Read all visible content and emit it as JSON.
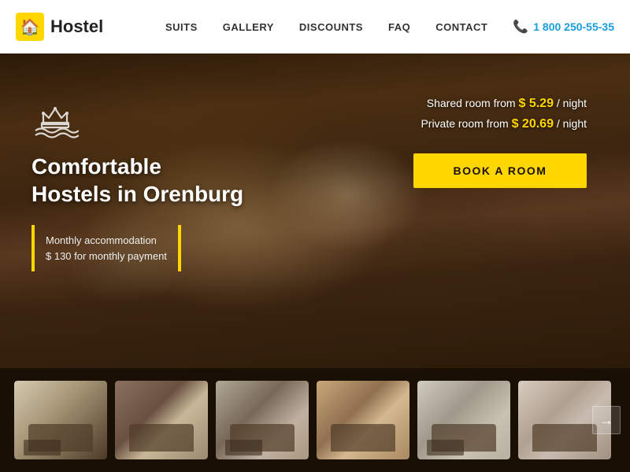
{
  "navbar": {
    "logo_icon": "🏠",
    "logo_text": "Hostel",
    "nav_items": [
      {
        "label": "SUITS",
        "id": "suits"
      },
      {
        "label": "GALLERY",
        "id": "gallery"
      },
      {
        "label": "DISCOUNTS",
        "id": "discounts"
      },
      {
        "label": "FAQ",
        "id": "faq"
      },
      {
        "label": "CONTACT",
        "id": "contact"
      }
    ],
    "phone_label": "1 800 250-55-35"
  },
  "hero": {
    "icon": "⚓",
    "title_line1": "Comfortable",
    "title_line2": "Hostels in Orenburg",
    "monthly_line1": "Monthly accommodation",
    "monthly_line2": "$ 130 for monthly payment",
    "shared_room_label": "Shared room from",
    "shared_price": "$ 5.29",
    "shared_suffix": "/ night",
    "private_room_label": "Private room from",
    "private_price": "$ 20.69",
    "private_suffix": "/ night",
    "book_button": "BOOK A ROOM"
  },
  "thumbnails": [
    {
      "id": 1,
      "class": "thumb-1"
    },
    {
      "id": 2,
      "class": "thumb-2"
    },
    {
      "id": 3,
      "class": "thumb-3"
    },
    {
      "id": 4,
      "class": "thumb-4"
    },
    {
      "id": 5,
      "class": "thumb-5"
    },
    {
      "id": 6,
      "class": "thumb-6"
    }
  ],
  "arrow": "→",
  "accent_color": "#FFD700",
  "accent_blue": "#1a9de0"
}
